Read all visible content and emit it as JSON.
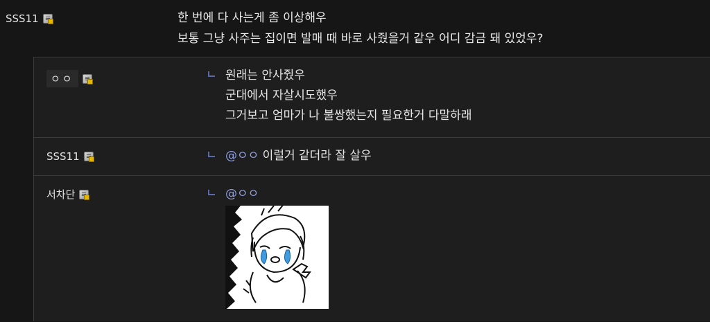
{
  "parent_comment": {
    "author": "SSS11",
    "lines": [
      "한 번에 다 사는게 좀 이상해우",
      "보통 그냥 사주는 집이면 발매 때 바로 사줬을거 같우 어디 감금 돼 있었우?"
    ]
  },
  "replies": [
    {
      "author": "ㅇㅇ",
      "lines": [
        "원래는 안사줬우",
        "군대에서 자살시도했우",
        "그거보고 엄마가 나 불쌍했는지 필요한거 다말하래"
      ]
    },
    {
      "author": "SSS11",
      "mention": "@ㅇㅇ",
      "text": " 이럴거 같더라 잘 살우"
    },
    {
      "author": "서차단",
      "mention": "@ㅇㅇ"
    }
  ],
  "icons": {
    "badge": "user-badge-icon",
    "reply_arrow": "reply-arrow-icon",
    "sticker": "crying-character-sticker"
  },
  "colors": {
    "background": "#161616",
    "reply_background": "#1e1e1e",
    "mention": "#8f9ee0",
    "reply_arrow": "#5a6aa8"
  }
}
